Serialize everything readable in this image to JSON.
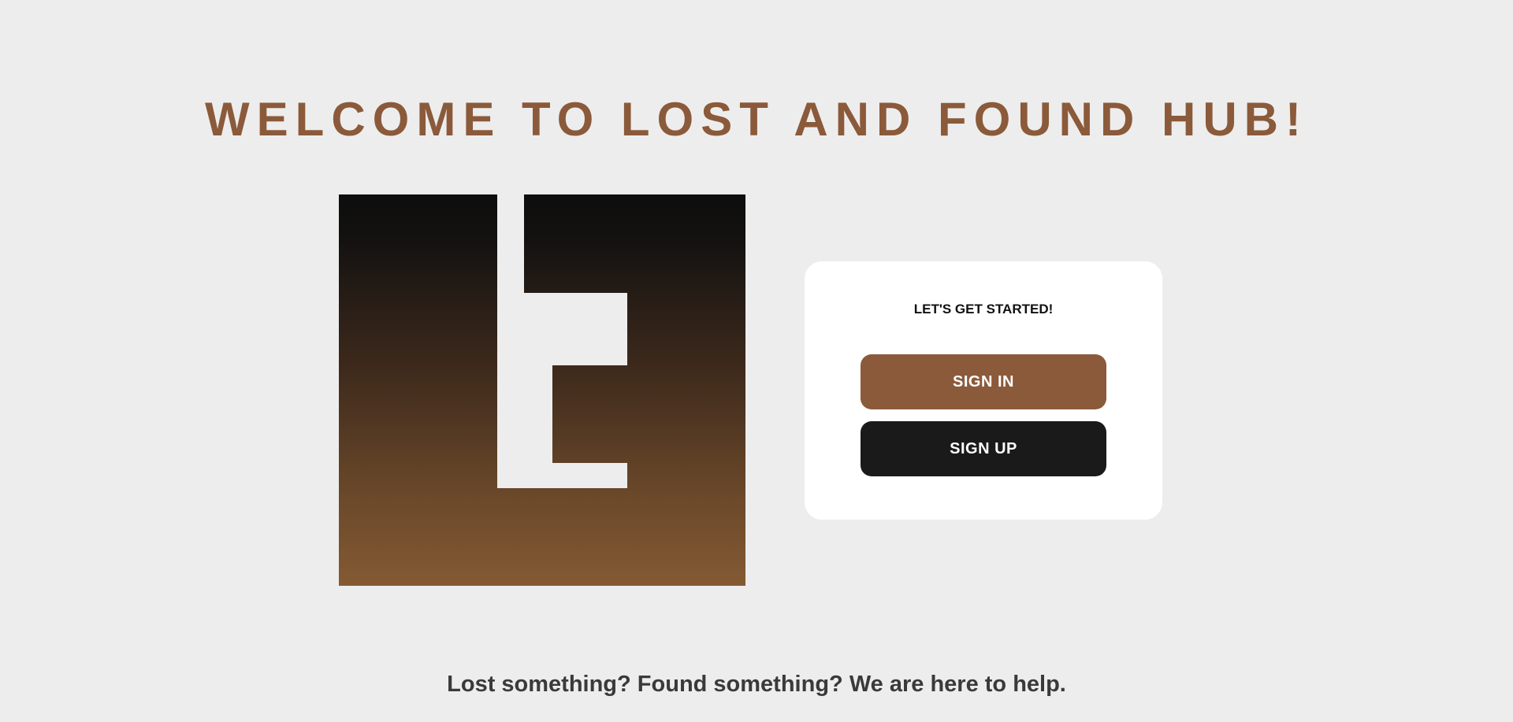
{
  "header": {
    "title": "WELCOME TO LOST AND FOUND HUB!"
  },
  "logo": {
    "icon": "lost-and-found-logo",
    "gradient_top": "#0d0d0d",
    "gradient_bottom": "#845a33"
  },
  "auth_card": {
    "heading": "LET'S GET STARTED!",
    "sign_in_label": "SIGN IN",
    "sign_up_label": "SIGN UP"
  },
  "footer": {
    "tagline": "Lost something? Found something? We are here to help."
  },
  "colors": {
    "accent": "#8b5a3a",
    "dark": "#1a1a1a",
    "background": "#ededed"
  }
}
